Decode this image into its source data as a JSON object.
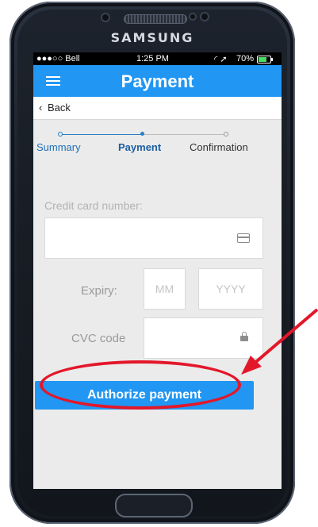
{
  "device": {
    "brand": "SAMSUNG"
  },
  "status_bar": {
    "carrier": "●●●○○ Bell",
    "time": "1:25 PM",
    "battery": "70%"
  },
  "app_bar": {
    "title": "Payment"
  },
  "nav": {
    "back_label": "Back"
  },
  "steps": [
    {
      "label": "Summary",
      "state": "done"
    },
    {
      "label": "Payment",
      "state": "active"
    },
    {
      "label": "Confirmation",
      "state": "pending"
    }
  ],
  "form": {
    "card_label": "Credit card number:",
    "card_value": "",
    "expiry_label": "Expiry:",
    "expiry_month_placeholder": "MM",
    "expiry_year_placeholder": "YYYY",
    "cvc_label": "CVC code",
    "cvc_value": "",
    "submit_label": "Authorize payment"
  },
  "colors": {
    "accent": "#2196f3",
    "annotation": "#e3172a"
  }
}
